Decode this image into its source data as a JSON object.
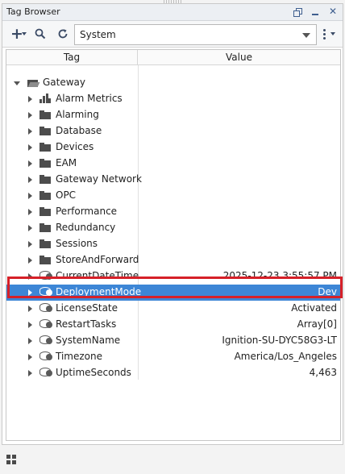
{
  "panel": {
    "title": "Tag Browser"
  },
  "toolbar": {
    "provider": "System"
  },
  "table": {
    "headers": {
      "tag": "Tag",
      "value": "Value"
    },
    "root": {
      "label": "Gateway"
    },
    "rows": [
      {
        "label": "Alarm Metrics",
        "icon": "bar-chart-icon",
        "value": ""
      },
      {
        "label": "Alarming",
        "icon": "folder-icon",
        "value": ""
      },
      {
        "label": "Database",
        "icon": "folder-icon",
        "value": ""
      },
      {
        "label": "Devices",
        "icon": "folder-icon",
        "value": ""
      },
      {
        "label": "EAM",
        "icon": "folder-icon",
        "value": ""
      },
      {
        "label": "Gateway Network",
        "icon": "folder-icon",
        "value": ""
      },
      {
        "label": "OPC",
        "icon": "folder-icon",
        "value": ""
      },
      {
        "label": "Performance",
        "icon": "folder-icon",
        "value": ""
      },
      {
        "label": "Redundancy",
        "icon": "folder-icon",
        "value": ""
      },
      {
        "label": "Sessions",
        "icon": "folder-icon",
        "value": ""
      },
      {
        "label": "StoreAndForward",
        "icon": "folder-icon",
        "value": ""
      },
      {
        "label": "CurrentDateTime",
        "icon": "tag-icon",
        "value": "2025-12-23 3:55:57 PM"
      },
      {
        "label": "DeploymentMode",
        "icon": "tag-icon",
        "value": "Dev",
        "selected": true
      },
      {
        "label": "LicenseState",
        "icon": "tag-icon",
        "value": "Activated"
      },
      {
        "label": "RestartTasks",
        "icon": "tag-icon",
        "value": "Array[0]"
      },
      {
        "label": "SystemName",
        "icon": "tag-icon",
        "value": "Ignition-SU-DYC58G3-LT"
      },
      {
        "label": "Timezone",
        "icon": "tag-icon",
        "value": "America/Los_Angeles"
      },
      {
        "label": "UptimeSeconds",
        "icon": "tag-icon",
        "value": "4,463"
      }
    ]
  },
  "colors": {
    "selection": "#3d86d6",
    "highlight": "#d62028",
    "accent": "#3b4b66"
  }
}
